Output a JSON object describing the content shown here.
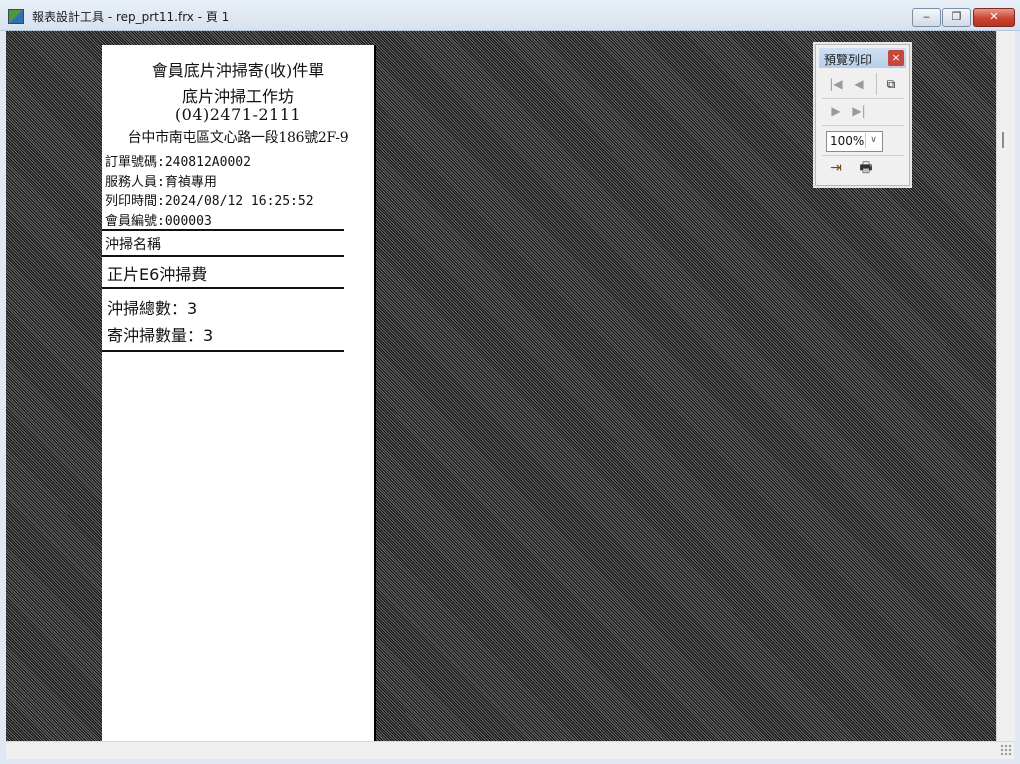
{
  "window": {
    "title": "報表設計工具 - rep_prt11.frx - 頁 1",
    "min_glyph": "‒",
    "max_glyph": "❐",
    "close_glyph": "✕"
  },
  "report": {
    "title_line1": "會員底片沖掃寄(收)件單",
    "title_line2": "底片沖掃工作坊",
    "phone": "(04)2471-2111",
    "address": "台中市南屯區文心路一段186號2F-9",
    "order_no": "訂單號碼:240812A0002",
    "staff": "服務人員:育禎專用",
    "print_time": "列印時間:2024/08/12 16:25:52",
    "member_no": "會員編號:000003",
    "column_header": "沖掃名稱",
    "item_name": "正片E6沖掃費",
    "total_label": "沖掃總數：3",
    "send_label": "寄沖掃數量：3"
  },
  "preview_toolbar": {
    "title": "預覽列印",
    "close_glyph": "×",
    "first_glyph": "|◀",
    "prev_glyph": "◀",
    "copy_glyph": "⧉",
    "next_glyph": "▶",
    "last_glyph": "▶|",
    "zoom_value": "100%",
    "zoom_arrow": "∨",
    "exit_glyph": "⇥",
    "print_glyph": "🖶"
  }
}
